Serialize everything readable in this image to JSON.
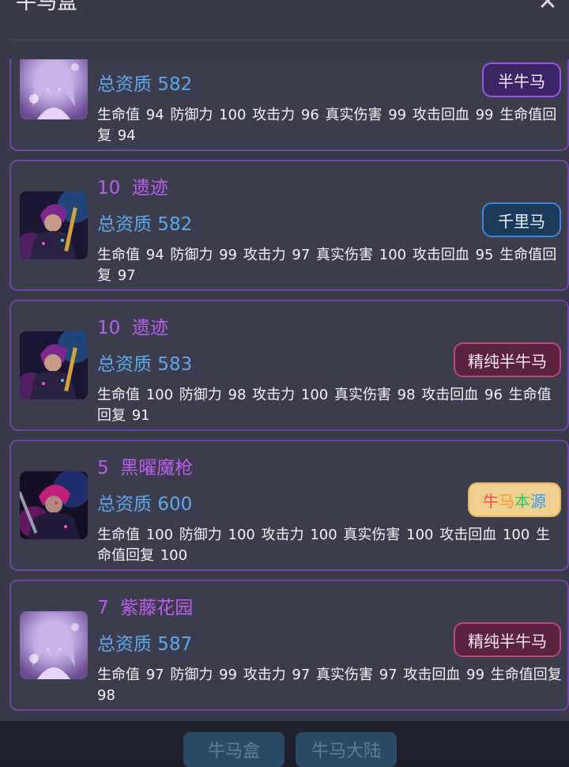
{
  "modal": {
    "title": "牛马盒",
    "close_icon": "close-icon",
    "cards": [
      {
        "name": "",
        "quality": "总资质 582",
        "stats": "生命值 94 防御力 100 攻击力 96 真实伤害 99 攻击回血 99 生命值回复 94",
        "badge": "半牛马",
        "badge_style": "purple",
        "avatar": "avatar-purple-haired-girl"
      },
      {
        "name": "10  遗迹",
        "quality": "总资质 582",
        "stats": "生命值 94 防御力 99 攻击力 97 真实伤害 100 攻击回血 95 生命值回复 97",
        "badge": "千里马",
        "badge_style": "blue",
        "avatar": "avatar-cyber-warrior"
      },
      {
        "name": "10  遗迹",
        "quality": "总资质 583",
        "stats": "生命值 100 防御力 98 攻击力 100 真实伤害 98 攻击回血 96 生命值回复 91",
        "badge": "精纯半牛马",
        "badge_style": "pink",
        "avatar": "avatar-cyber-warrior"
      },
      {
        "name": "5  黑曜魔枪",
        "quality": "总资质 600",
        "stats": "生命值 100 防御力 100 攻击力 100 真实伤害 100 攻击回血 100 生命值回复 100",
        "badge": "牛马本源",
        "badge_style": "gold",
        "avatar": "avatar-red-eyed-warrior"
      },
      {
        "name": "7  紫藤花园",
        "quality": "总资质 587",
        "stats": "生命值 97 防御力 99 攻击力 97 真实伤害 97 攻击回血 99 生命值回复 98",
        "badge": "精纯半牛马",
        "badge_style": "pink",
        "avatar": "avatar-purple-haired-girl"
      }
    ]
  },
  "bottom_tabs": [
    "牛马盒",
    "牛马大陆"
  ],
  "colors": {
    "modal_bg": "#3a3948",
    "card_border": "#6f44a8",
    "name_color": "#b85ff0",
    "quality_color": "#5aa9ee",
    "rainbow": [
      "#ff4d4d",
      "#ff9a2e",
      "#2fc66a",
      "#2e9bff"
    ]
  }
}
